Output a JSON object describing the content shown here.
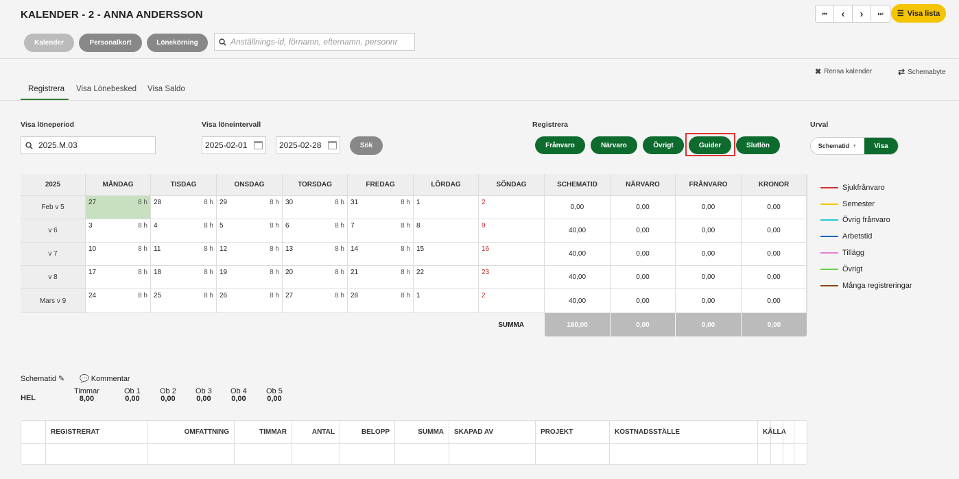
{
  "header": {
    "title": "KALENDER - 2 - ANNA ANDERSSON",
    "visa_lista": "Visa lista"
  },
  "nav": {
    "first": "⏮",
    "prev": "‹",
    "next": "›",
    "last": "⏭"
  },
  "buttons": {
    "kalender": "Kalender",
    "personalkort": "Personalkort",
    "lonekorning": "Lönekörning"
  },
  "search": {
    "placeholder": "Anställnings-id, förnamn, efternamn, personnr"
  },
  "toplinks": {
    "rensa": "Rensa kalender",
    "schemabyte": "Schemabyte"
  },
  "tabs": [
    "Registrera",
    "Visa Lönebesked",
    "Visa Saldo"
  ],
  "filters": {
    "period_label": "Visa löneperiod",
    "period_value": "2025.M.03",
    "interval_label": "Visa löneintervall",
    "from": "2025-02-01",
    "to": "2025-02-28",
    "sok": "Sök",
    "registrera_label": "Registrera",
    "franvaro": "Frånvaro",
    "narvaro": "Närvaro",
    "ovrigt": "Övrigt",
    "guider": "Guider",
    "slutlon": "Slutlön",
    "urval_label": "Urval",
    "urval_value": "Schematid",
    "visa": "Visa"
  },
  "calendar": {
    "year": "2025",
    "days": [
      "MÅNDAG",
      "TISDAG",
      "ONSDAG",
      "TORSDAG",
      "FREDAG",
      "LÖRDAG",
      "SÖNDAG"
    ],
    "sumcols": [
      "SCHEMATID",
      "NÄRVARO",
      "FRÅNVARO",
      "KRONOR"
    ],
    "weeks": [
      {
        "label": "Feb v 5",
        "dates": [
          "27",
          "28",
          "29",
          "30",
          "31",
          "1",
          "2"
        ],
        "hours": [
          "8 h",
          "8 h",
          "8 h",
          "8 h",
          "8 h",
          "",
          ""
        ],
        "sums": [
          "0,00",
          "0,00",
          "0,00",
          "0,00"
        ]
      },
      {
        "label": "v 6",
        "dates": [
          "3",
          "4",
          "5",
          "6",
          "7",
          "8",
          "9"
        ],
        "hours": [
          "8 h",
          "8 h",
          "8 h",
          "8 h",
          "8 h",
          "",
          ""
        ],
        "sums": [
          "40,00",
          "0,00",
          "0,00",
          "0,00"
        ]
      },
      {
        "label": "v 7",
        "dates": [
          "10",
          "11",
          "12",
          "13",
          "14",
          "15",
          "16"
        ],
        "hours": [
          "8 h",
          "8 h",
          "8 h",
          "8 h",
          "8 h",
          "",
          ""
        ],
        "sums": [
          "40,00",
          "0,00",
          "0,00",
          "0,00"
        ]
      },
      {
        "label": "v 8",
        "dates": [
          "17",
          "18",
          "19",
          "20",
          "21",
          "22",
          "23"
        ],
        "hours": [
          "8 h",
          "8 h",
          "8 h",
          "8 h",
          "8 h",
          "",
          ""
        ],
        "sums": [
          "40,00",
          "0,00",
          "0,00",
          "0,00"
        ]
      },
      {
        "label": "Mars v 9",
        "dates": [
          "24",
          "25",
          "26",
          "27",
          "28",
          "1",
          "2"
        ],
        "hours": [
          "8 h",
          "8 h",
          "8 h",
          "8 h",
          "8 h",
          "",
          ""
        ],
        "sums": [
          "40,00",
          "0,00",
          "0,00",
          "0,00"
        ]
      }
    ],
    "summa_label": "SUMMA",
    "summa": [
      "160,00",
      "0,00",
      "0,00",
      "0,00"
    ]
  },
  "legend": [
    {
      "label": "Sjukfrånvaro",
      "color": "#d32f2f"
    },
    {
      "label": "Semester",
      "color": "#f5c400"
    },
    {
      "label": "Övrig frånvaro",
      "color": "#26c6da"
    },
    {
      "label": "Arbetstid",
      "color": "#1565c0"
    },
    {
      "label": "Tillägg",
      "color": "#e57fd0"
    },
    {
      "label": "Övrigt",
      "color": "#66cc44"
    },
    {
      "label": "Många registreringar",
      "color": "#8b4513"
    }
  ],
  "schema": {
    "schematid": "Schematid",
    "kommentar": "Kommentar",
    "hel": "HEL",
    "cols": [
      {
        "h": "Timmar",
        "v": "8,00"
      },
      {
        "h": "Ob 1",
        "v": "0,00"
      },
      {
        "h": "Ob 2",
        "v": "0,00"
      },
      {
        "h": "Ob 3",
        "v": "0,00"
      },
      {
        "h": "Ob 4",
        "v": "0,00"
      },
      {
        "h": "Ob 5",
        "v": "0,00"
      }
    ]
  },
  "table": {
    "headers": [
      "REGISTRERAT",
      "OMFATTNING",
      "TIMMAR",
      "ANTAL",
      "BELOPP",
      "SUMMA",
      "SKAPAD AV",
      "PROJEKT",
      "KOSTNADSSTÄLLE",
      "KÄLLA"
    ]
  }
}
